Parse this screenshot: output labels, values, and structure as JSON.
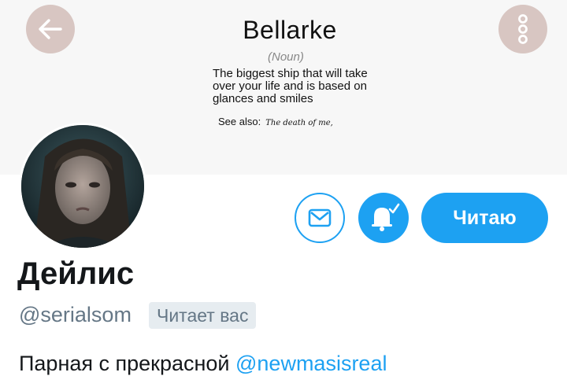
{
  "banner": {
    "title": "Bellarke",
    "part_of_speech": "(Noun)",
    "definition": "The biggest ship that will take over your life and is based on glances and smiles",
    "see_also_label": "See also:",
    "see_also_value": "The death of me,"
  },
  "profile": {
    "display_name": "Дейлис",
    "handle": "@serialsom",
    "follows_you": "Читает вас",
    "bio_text": "Парная с прекрасной ",
    "bio_mention": "@newmasisreal"
  },
  "actions": {
    "follow_label": "Читаю"
  },
  "colors": {
    "accent": "#1da1f2",
    "nav_button_bg": "#d8c6c2"
  },
  "icons": [
    "back-arrow-icon",
    "more-vertical-icon",
    "mail-icon",
    "bell-check-icon"
  ]
}
